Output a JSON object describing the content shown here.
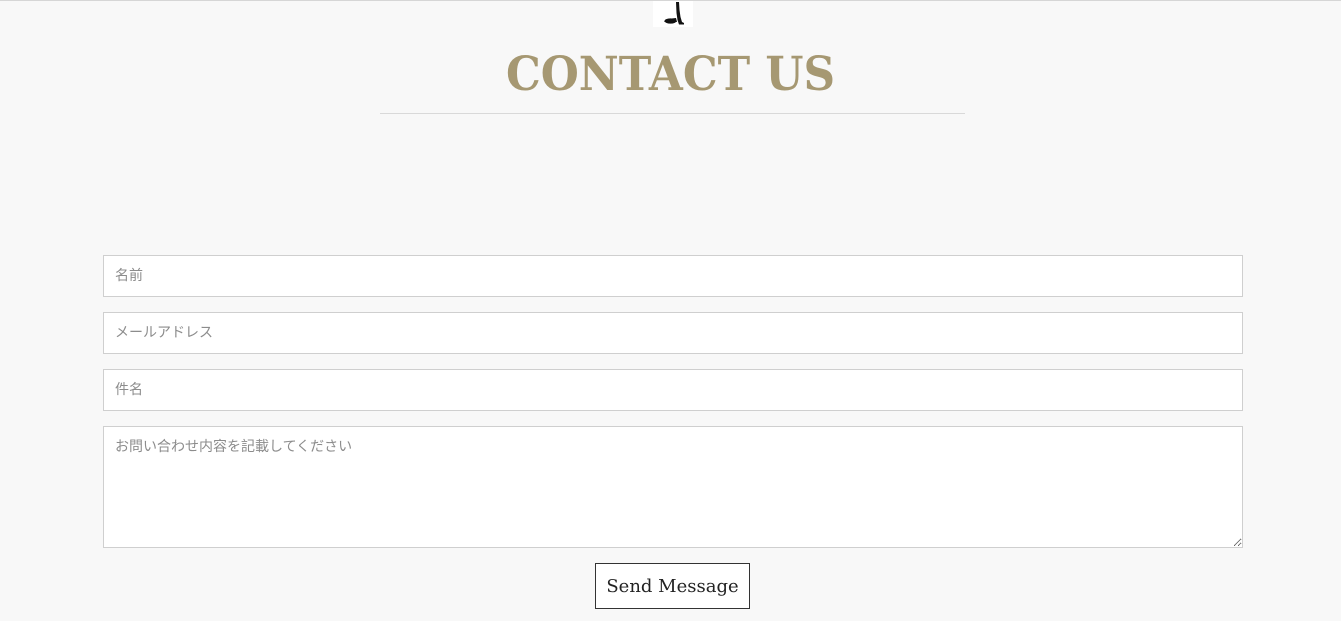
{
  "header": {
    "logo_icon": "seated-figure-logo-icon",
    "title": "CONTACT US"
  },
  "form": {
    "name_placeholder": "名前",
    "email_placeholder": "メールアドレス",
    "subject_placeholder": "件名",
    "message_placeholder": "お問い合わせ内容を記載してください",
    "submit_label": "Send Message"
  },
  "colors": {
    "background": "#f8f8f8",
    "title": "#a69872",
    "field_border": "#cfcfcf",
    "button_border": "#333333"
  }
}
